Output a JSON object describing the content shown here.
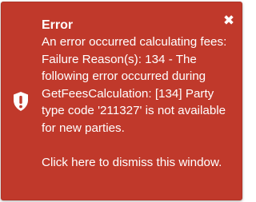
{
  "toast": {
    "type": "error",
    "background_color": "#c0392b",
    "icon": "exclamation-shield-icon",
    "close_icon": "close-icon",
    "title": "Error",
    "message": "An error occurred calculating fees: Failure Reason(s): 134 - The following error occurred during GetFeesCalculation: [134] Party type code '211327' is not available for new parties.",
    "dismiss_text": "Click here to dismiss this window."
  }
}
